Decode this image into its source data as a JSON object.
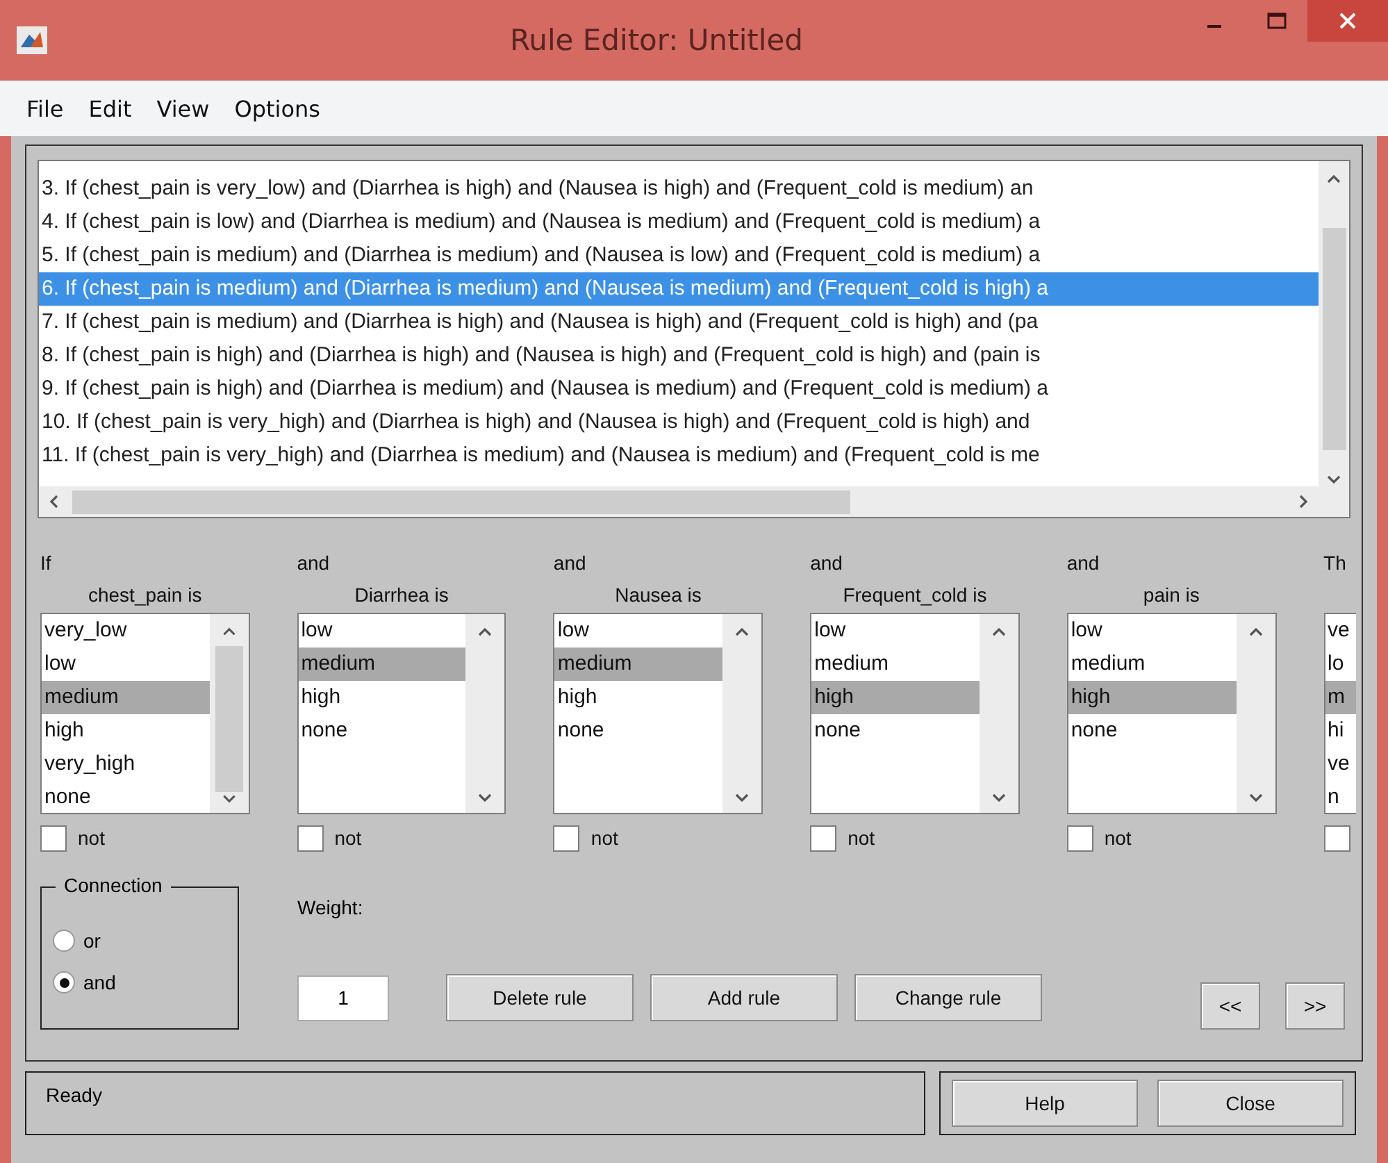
{
  "window": {
    "title": "Rule Editor: Untitled"
  },
  "menu": [
    "File",
    "Edit",
    "View",
    "Options"
  ],
  "rules": [
    {
      "text": "3. If (chest_pain is very_low) and (Diarrhea is high) and (Nausea is high) and (Frequent_cold is medium) an",
      "selected": false
    },
    {
      "text": "4. If (chest_pain is low) and (Diarrhea is medium) and (Nausea is medium) and (Frequent_cold is medium) a",
      "selected": false
    },
    {
      "text": "5. If (chest_pain is medium) and (Diarrhea is medium) and (Nausea is low) and (Frequent_cold is medium) a",
      "selected": false
    },
    {
      "text": "6. If (chest_pain is medium) and (Diarrhea is medium) and (Nausea is medium) and (Frequent_cold is high) a",
      "selected": true
    },
    {
      "text": "7. If (chest_pain is medium) and (Diarrhea is high) and (Nausea is high) and (Frequent_cold is high) and (pa",
      "selected": false
    },
    {
      "text": "8. If (chest_pain is high) and (Diarrhea is high) and (Nausea is high) and (Frequent_cold is high) and (pain is",
      "selected": false
    },
    {
      "text": "9. If (chest_pain is high) and (Diarrhea is medium) and (Nausea is medium) and (Frequent_cold is medium) a",
      "selected": false
    },
    {
      "text": "10. If (chest_pain is very_high) and (Diarrhea is high) and (Nausea is high) and (Frequent_cold is high) and",
      "selected": false
    },
    {
      "text": "11. If (chest_pain is very_high) and (Diarrhea is medium) and (Nausea is medium) and (Frequent_cold is me",
      "selected": false
    }
  ],
  "inputs": [
    {
      "connector": "If",
      "label": "chest_pain is",
      "options": [
        {
          "label": "very_low",
          "selected": false
        },
        {
          "label": "low",
          "selected": false
        },
        {
          "label": "medium",
          "selected": true
        },
        {
          "label": "high",
          "selected": false
        },
        {
          "label": "very_high",
          "selected": false
        },
        {
          "label": "none",
          "selected": false
        }
      ],
      "not": {
        "label": "not",
        "checked": false
      }
    },
    {
      "connector": "and",
      "label": "Diarrhea is",
      "options": [
        {
          "label": "low",
          "selected": false
        },
        {
          "label": "medium",
          "selected": true
        },
        {
          "label": "high",
          "selected": false
        },
        {
          "label": "none",
          "selected": false
        }
      ],
      "not": {
        "label": "not",
        "checked": false
      }
    },
    {
      "connector": "and",
      "label": "Nausea is",
      "options": [
        {
          "label": "low",
          "selected": false
        },
        {
          "label": "medium",
          "selected": true
        },
        {
          "label": "high",
          "selected": false
        },
        {
          "label": "none",
          "selected": false
        }
      ],
      "not": {
        "label": "not",
        "checked": false
      }
    },
    {
      "connector": "and",
      "label": "Frequent_cold is",
      "options": [
        {
          "label": "low",
          "selected": false
        },
        {
          "label": "medium",
          "selected": false
        },
        {
          "label": "high",
          "selected": true
        },
        {
          "label": "none",
          "selected": false
        }
      ],
      "not": {
        "label": "not",
        "checked": false
      }
    },
    {
      "connector": "and",
      "label": "pain is",
      "options": [
        {
          "label": "low",
          "selected": false
        },
        {
          "label": "medium",
          "selected": false
        },
        {
          "label": "high",
          "selected": true
        },
        {
          "label": "none",
          "selected": false
        }
      ],
      "not": {
        "label": "not",
        "checked": false
      }
    },
    {
      "kind": "partial",
      "connector": "Th",
      "options": [
        {
          "label": "ve",
          "selected": false
        },
        {
          "label": "lo",
          "selected": false
        },
        {
          "label": "m",
          "selected": true
        },
        {
          "label": "hi",
          "selected": false
        },
        {
          "label": "ve",
          "selected": false
        },
        {
          "label": "n",
          "selected": false
        }
      ],
      "not": {
        "checked": false
      }
    }
  ],
  "connection": {
    "title": "Connection",
    "options": [
      {
        "label": "or",
        "selected": false
      },
      {
        "label": "and",
        "selected": true
      }
    ]
  },
  "weight": {
    "label": "Weight:",
    "value": "1"
  },
  "buttons": [
    "Delete rule",
    "Add rule",
    "Change rule"
  ],
  "nav_buttons": [
    "<<",
    ">>"
  ],
  "status": "Ready",
  "footer_buttons": [
    "Help",
    "Close"
  ]
}
